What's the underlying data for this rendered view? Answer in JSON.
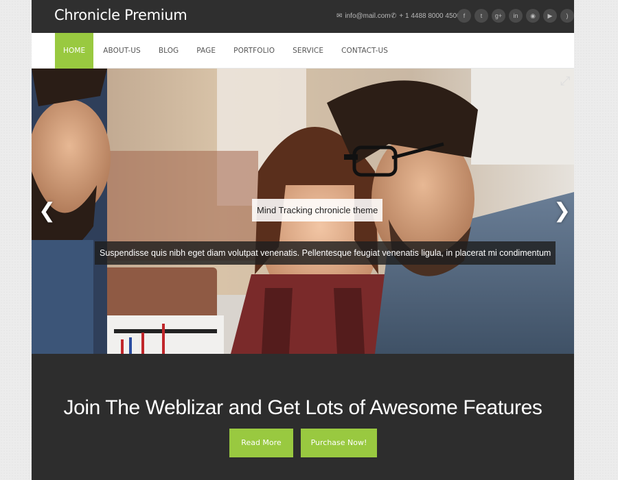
{
  "header": {
    "brand": "Chronicle Premium",
    "email": "info@mail.com",
    "phone": "+ 1 4488 8000 4500",
    "email_icon": "envelope-icon",
    "phone_icon": "phone-icon",
    "social": [
      {
        "name": "facebook-icon",
        "glyph": "f"
      },
      {
        "name": "twitter-icon",
        "glyph": "t"
      },
      {
        "name": "google-plus-icon",
        "glyph": "g+"
      },
      {
        "name": "linkedin-icon",
        "glyph": "in"
      },
      {
        "name": "flickr-icon",
        "glyph": "◉"
      },
      {
        "name": "youtube-icon",
        "glyph": "▶"
      },
      {
        "name": "rss-icon",
        "glyph": ")"
      }
    ]
  },
  "nav": {
    "items": [
      {
        "label": "HOME",
        "active": true
      },
      {
        "label": "ABOUT-US",
        "active": false
      },
      {
        "label": "BLOG",
        "active": false
      },
      {
        "label": "PAGE",
        "active": false
      },
      {
        "label": "PORTFOLIO",
        "active": false
      },
      {
        "label": "SERVICE",
        "active": false
      },
      {
        "label": "CONTACT-US",
        "active": false
      }
    ]
  },
  "slider": {
    "prev_glyph": "❮",
    "next_glyph": "❯",
    "expand_glyph": "⤢",
    "caption_title": "Mind Tracking chronicle theme",
    "caption_text": "Suspendisse quis nibh eget diam volutpat venenatis. Pellentesque feugiat venenatis ligula, in placerat mi condimentum"
  },
  "cta": {
    "title": "Join The Weblizar and Get Lots of Awesome Features",
    "read_more": "Read More",
    "purchase": "Purchase Now!"
  },
  "colors": {
    "accent": "#99c940",
    "topbar": "#2f2f2f",
    "cta_bg": "#2d2d2d"
  }
}
